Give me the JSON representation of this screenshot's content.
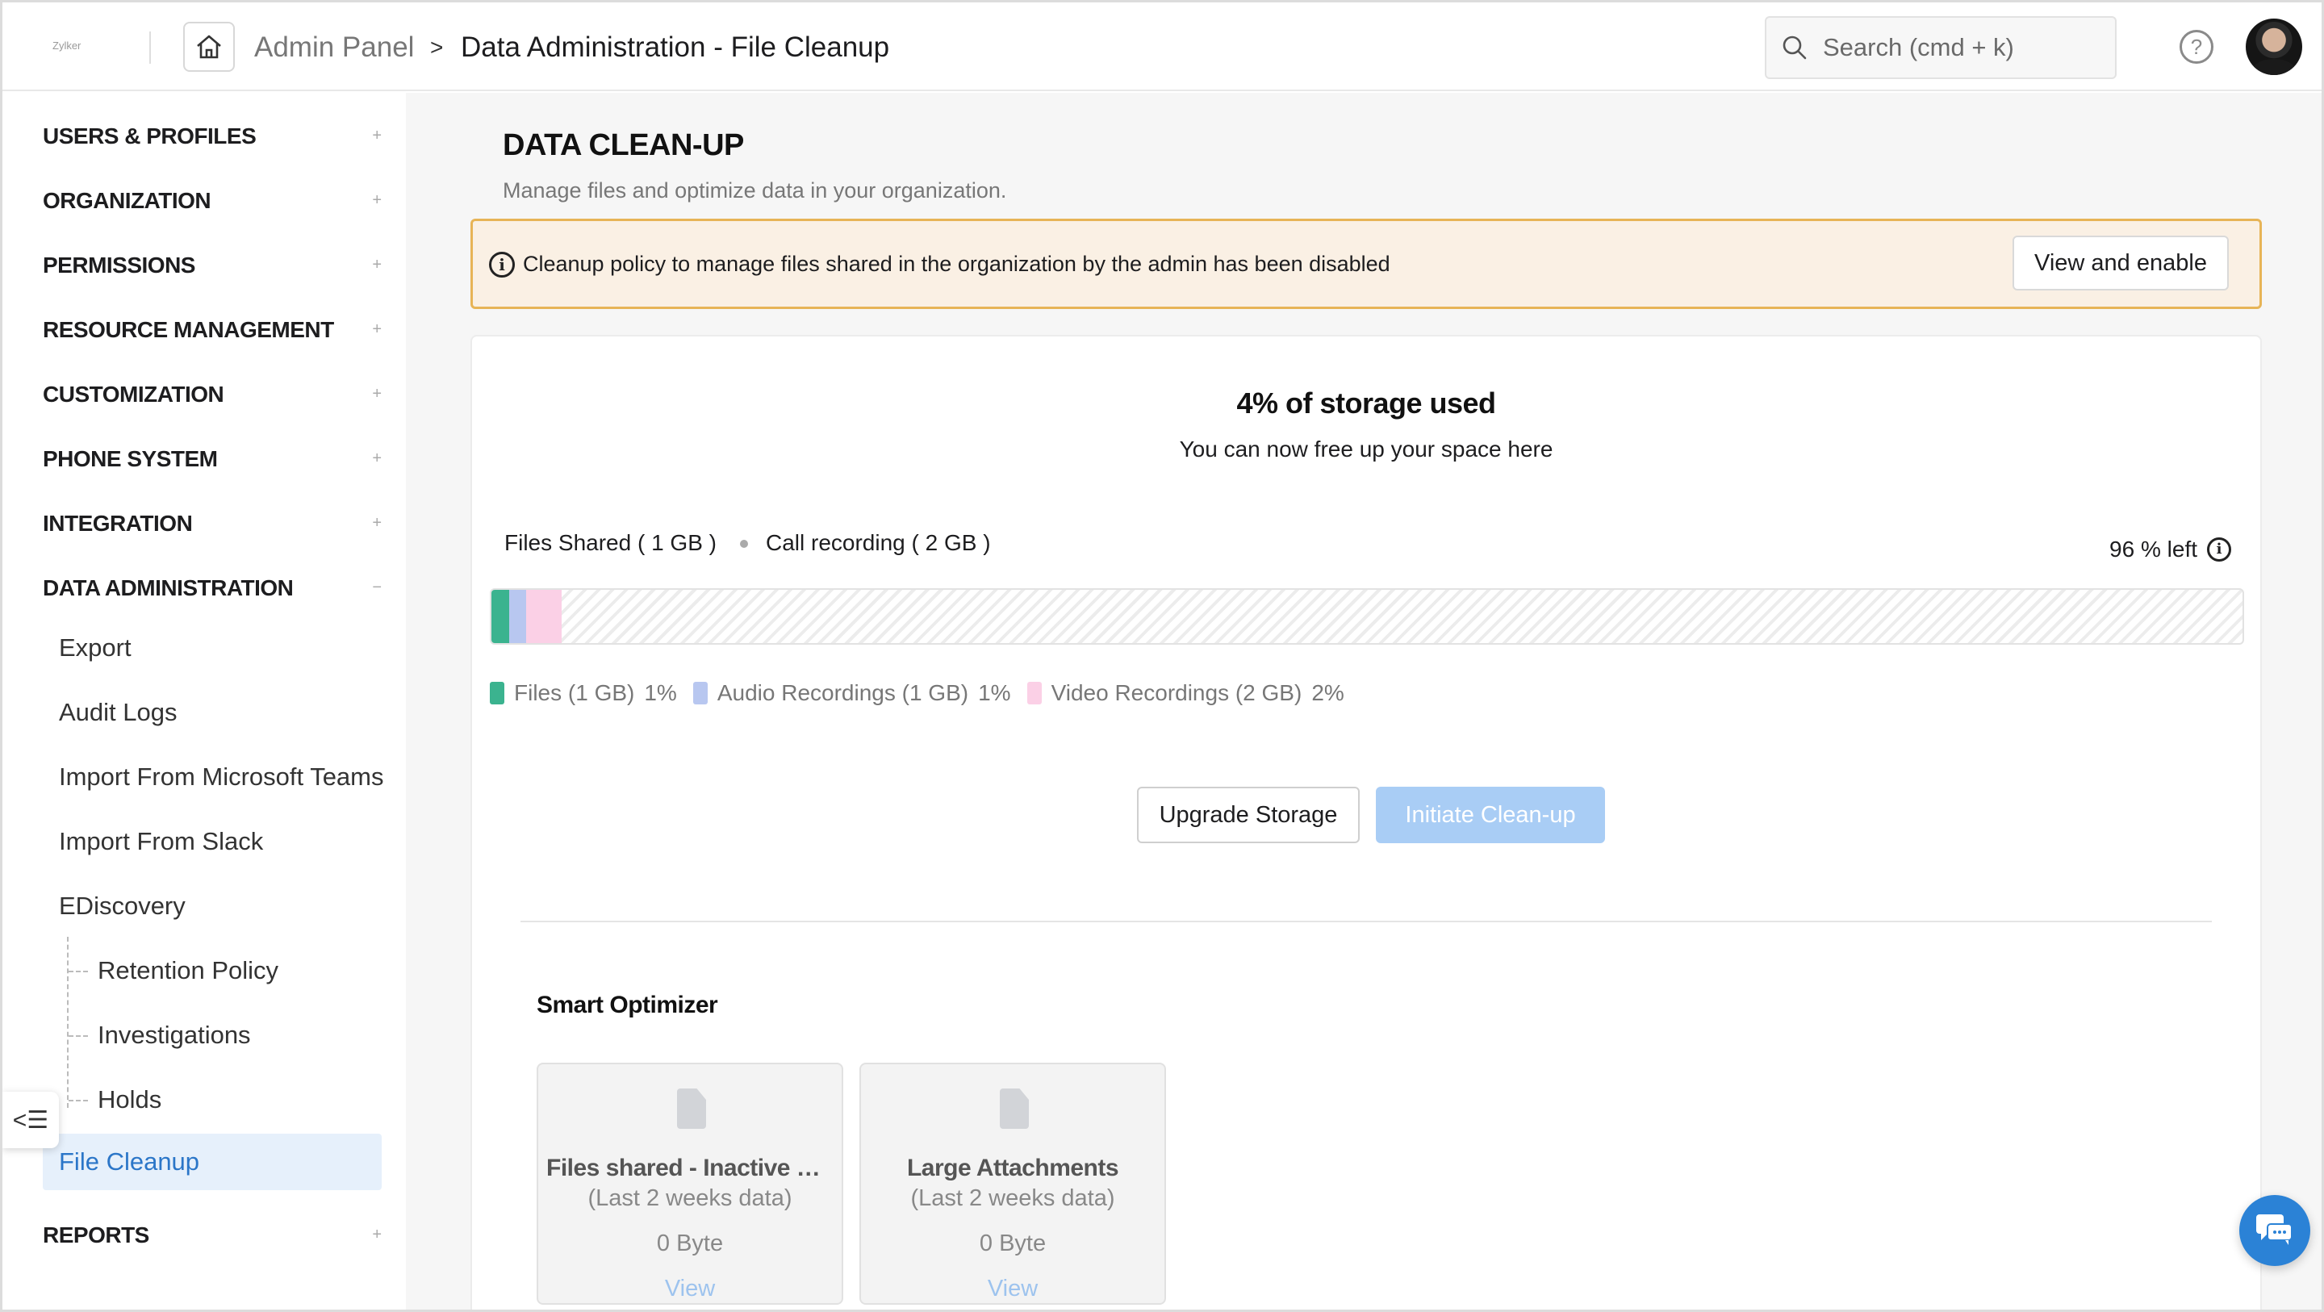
{
  "header": {
    "logo_text": "Zylker",
    "breadcrumb_root": "Admin Panel",
    "breadcrumb_separator": ">",
    "breadcrumb_current": "Data Administration - File Cleanup",
    "search_placeholder": "Search (cmd + k)",
    "help_glyph": "?"
  },
  "sidebar": {
    "sections": [
      {
        "label": "USERS & PROFILES",
        "toggle": "+"
      },
      {
        "label": "ORGANIZATION",
        "toggle": "+"
      },
      {
        "label": "PERMISSIONS",
        "toggle": "+"
      },
      {
        "label": "RESOURCE MANAGEMENT",
        "toggle": "+"
      },
      {
        "label": "CUSTOMIZATION",
        "toggle": "+"
      },
      {
        "label": "PHONE SYSTEM",
        "toggle": "+"
      },
      {
        "label": "INTEGRATION",
        "toggle": "+"
      },
      {
        "label": "DATA ADMINISTRATION",
        "toggle": "−"
      },
      {
        "label": "REPORTS",
        "toggle": "+"
      }
    ],
    "data_admin_items": [
      "Export",
      "Audit Logs",
      "Import From Microsoft Teams",
      "Import From Slack",
      "EDiscovery"
    ],
    "ediscovery_items": [
      "Retention Policy",
      "Investigations",
      "Holds"
    ],
    "active_item": "File Cleanup",
    "collapse_glyph": "<☰"
  },
  "main": {
    "title": "DATA CLEAN-UP",
    "subtitle": "Manage files and optimize data in your organization.",
    "alert": {
      "text": "Cleanup policy to manage files shared in the organization by the admin has been disabled",
      "button": "View and enable",
      "icon": "info-icon"
    },
    "storage": {
      "title": "4% of storage used",
      "subtitle": "You can now free up your space here",
      "files_shared": "Files Shared ( 1 GB )",
      "call_recording": "Call recording ( 2 GB )",
      "left_text": "96 % left",
      "segments": [
        {
          "label": "Files",
          "size": "(1 GB)",
          "pct_text": "1%",
          "pct": 1,
          "color": "#3bb38f"
        },
        {
          "label": "Audio Recordings",
          "size": "(1 GB)",
          "pct_text": "1%",
          "pct": 1,
          "color": "#b8c7f0"
        },
        {
          "label": "Video Recordings",
          "size": "(2 GB)",
          "pct_text": "2%",
          "pct": 2,
          "color": "#fbd0e6"
        }
      ]
    },
    "buttons": {
      "upgrade": "Upgrade Storage",
      "initiate": "Initiate Clean-up"
    },
    "optimizer": {
      "title": "Smart Optimizer",
      "cards": [
        {
          "name": "Files shared - Inactive users",
          "period": "(Last 2 weeks data)",
          "size": "0 Byte",
          "action": "View"
        },
        {
          "name": "Large Attachments",
          "period": "(Last 2 weeks data)",
          "size": "0 Byte",
          "action": "View"
        }
      ]
    }
  }
}
